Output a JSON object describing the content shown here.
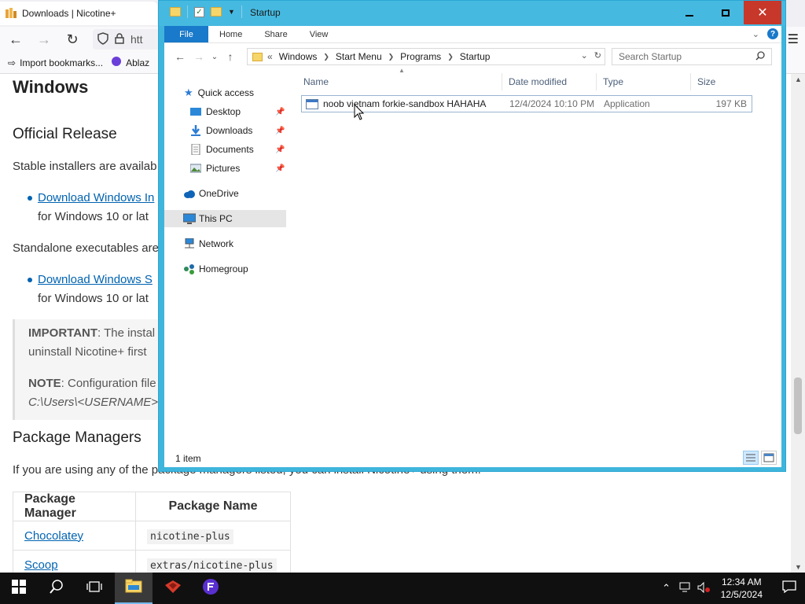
{
  "browser": {
    "tab_title": "Downloads | Nicotine+",
    "url_partial": "htt",
    "bookmarks": [
      {
        "label": "Import bookmarks..."
      },
      {
        "label": "Ablaz"
      }
    ],
    "content": {
      "h1": "Windows",
      "official_heading": "Official Release",
      "official_text": "Stable installers are availab",
      "installer_link": "Download Windows In",
      "installer_note": "for Windows 10 or lat",
      "standalone_text": "Standalone executables are",
      "standalone_link": "Download Windows S",
      "standalone_note": "for Windows 10 or lat",
      "important_label": "IMPORTANT",
      "important_text": ": The instal",
      "important_line2": "uninstall Nicotine+ first",
      "note_label": "NOTE",
      "note_text": ": Configuration file",
      "note_path": "C:\\Users\\<USERNAME>",
      "package_heading": "Package Managers",
      "package_text": "If you are using any of the package managers listed, you can install Nicotine+ using them.",
      "table_headers": [
        "Package Manager",
        "Package Name"
      ],
      "table_rows": [
        {
          "manager": "Chocolatey",
          "package": "nicotine-plus"
        },
        {
          "manager": "Scoop",
          "package": "extras/nicotine-plus"
        }
      ]
    }
  },
  "explorer": {
    "window_title": "Startup",
    "ribbon_tabs": [
      "File",
      "Home",
      "Share",
      "View"
    ],
    "breadcrumbs": [
      "Windows",
      "Start Menu",
      "Programs",
      "Startup"
    ],
    "breadcrumb_overflow": "«",
    "search_placeholder": "Search Startup",
    "nav": {
      "quick_access": "Quick access",
      "desktop": "Desktop",
      "downloads": "Downloads",
      "documents": "Documents",
      "pictures": "Pictures",
      "onedrive": "OneDrive",
      "this_pc": "This PC",
      "network": "Network",
      "homegroup": "Homegroup"
    },
    "columns": [
      "Name",
      "Date modified",
      "Type",
      "Size"
    ],
    "files": [
      {
        "name": "noob vietnam forkie-sandbox HAHAHA",
        "date": "12/4/2024 10:10 PM",
        "type": "Application",
        "size": "197 KB"
      }
    ],
    "status": "1 item"
  },
  "taskbar": {
    "time": "12:34 AM",
    "date": "12/5/2024"
  },
  "colors": {
    "explorer_frame": "#46b9e0",
    "close_button": "#c7372a",
    "ribbon_file_tab": "#1979ca",
    "taskbar": "#101010"
  }
}
